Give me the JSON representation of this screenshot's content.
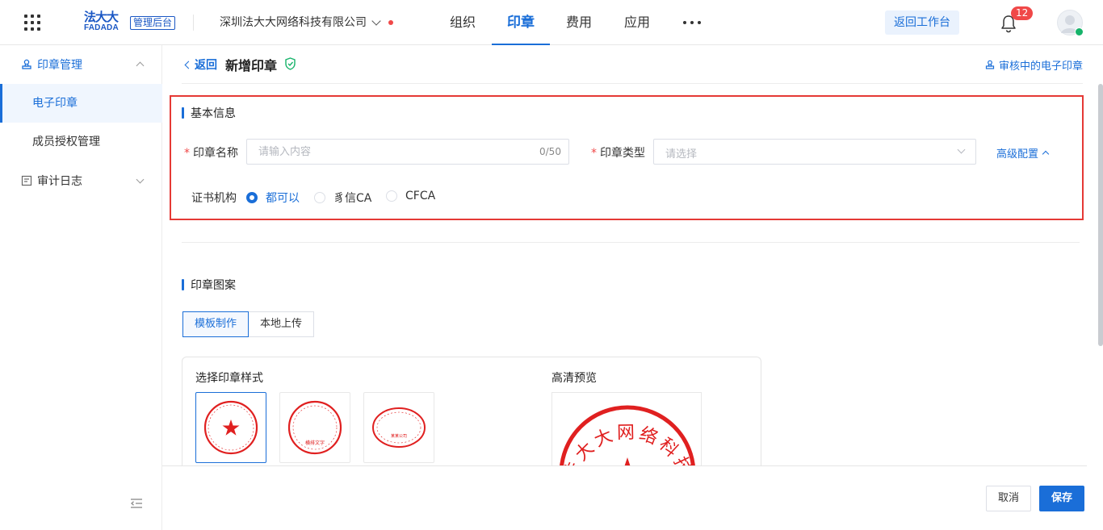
{
  "header": {
    "logo_cn": "法大大",
    "logo_en": "FADADA",
    "admin_badge": "管理后台",
    "company": "深圳法大大网络科技有限公司",
    "nav": [
      "组织",
      "印章",
      "费用",
      "应用"
    ],
    "active_nav": "印章",
    "back_workbench": "返回工作台",
    "notification_count": "12"
  },
  "sidebar": {
    "groups": [
      {
        "label": "印章管理",
        "icon": "seal-icon",
        "expanded": true
      },
      {
        "label": "审计日志",
        "icon": "log-icon",
        "expanded": false
      }
    ],
    "items": [
      "电子印章",
      "成员授权管理"
    ],
    "active_item": "电子印章"
  },
  "page": {
    "back": "返回",
    "title": "新增印章",
    "audit_link": "审核中的电子印章"
  },
  "basic_info": {
    "section_title": "基本信息",
    "seal_name_label": "印章名称",
    "seal_name_placeholder": "请输入内容",
    "seal_name_counter": "0/50",
    "seal_type_label": "印章类型",
    "seal_type_placeholder": "请选择",
    "advanced": "高级配置",
    "cert_label": "证书机构",
    "cert_options": [
      "都可以",
      "豸信CA",
      "CFCA"
    ],
    "cert_selected": "都可以"
  },
  "seal_pattern": {
    "section_title": "印章图案",
    "tabs": [
      "模板制作",
      "本地上传"
    ],
    "active_tab": "模板制作",
    "style_title": "选择印章样式",
    "preview_title": "高清预览",
    "preview_text": "法大大网络科技有限",
    "style_sample_text": "横排文字",
    "style_sample_text_2": "某某公司"
  },
  "footer": {
    "cancel": "取消",
    "save": "保存"
  },
  "colors": {
    "primary": "#1a6ed8",
    "seal_red": "#e02020",
    "highlight": "#e53935"
  }
}
